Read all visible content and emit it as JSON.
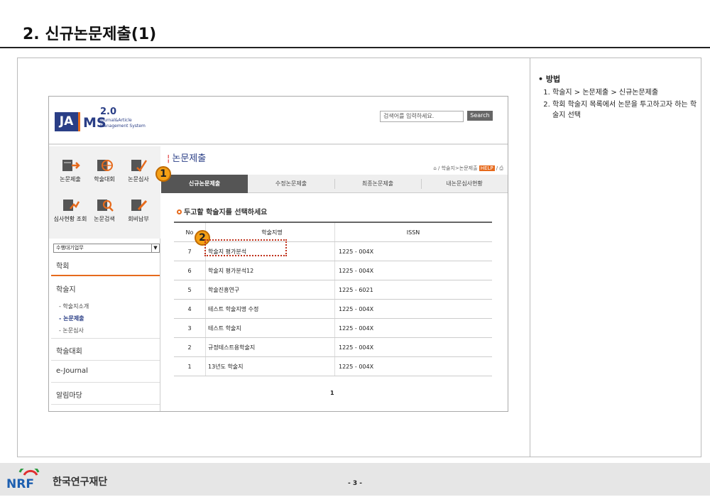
{
  "slide": {
    "title": "2. 신규논문제출(1)",
    "page_number": "- 3 -"
  },
  "notes": {
    "heading": "• 방법",
    "steps": [
      "학술지 > 논문제출 > 신규논문제출",
      "학회 학술지 목록에서 논문을 투고하고자 하는 학술지 선택"
    ]
  },
  "app": {
    "logo": {
      "ja": "JA",
      "ms": "MS",
      "version": "2.0",
      "subtitle": "Journal&Article Management System"
    },
    "search": {
      "placeholder": "검색어를 입력하세요.",
      "button": "Search"
    },
    "quick_icons": [
      {
        "label": "논문제출",
        "icon": "document-arrow-icon"
      },
      {
        "label": "학술대회",
        "icon": "globe-document-icon"
      },
      {
        "label": "논문심사",
        "icon": "pencil-check-icon"
      },
      {
        "label": "심사현황 조회",
        "icon": "chart-document-icon"
      },
      {
        "label": "논문검색",
        "icon": "magnifier-document-icon"
      },
      {
        "label": "회비납부",
        "icon": "pencil-document-icon"
      }
    ],
    "quick_select": "수행대기업무",
    "menu": {
      "society": "학회",
      "journal": "학술지",
      "journal_sub": [
        "- 학술지소개",
        "- 논문제출",
        "- 논문심사"
      ],
      "conference": "학술대회",
      "ejournal": "e-Journal",
      "notice": "알림마당"
    },
    "page_heading": "논문제출",
    "breadcrumb": {
      "path": "학술지>논문제출",
      "tag": "HELP"
    },
    "tabs": [
      "신규논문제출",
      "수정논문제출",
      "최종논문제출",
      "내논문심사현황"
    ],
    "active_tab": 0,
    "section_title": "두고할 학술지를 선택하세요",
    "table": {
      "headers": [
        "No",
        "학술지명",
        "ISSN"
      ],
      "rows": [
        {
          "no": "7",
          "name": "학술지 평가분석",
          "issn": "1225 - 004X"
        },
        {
          "no": "6",
          "name": "학술지 평가분석12",
          "issn": "1225 - 004X"
        },
        {
          "no": "5",
          "name": "학술진흥연구",
          "issn": "1225 - 6021"
        },
        {
          "no": "4",
          "name": "테스트 학술지명 수정",
          "issn": "1225 - 004X"
        },
        {
          "no": "3",
          "name": "테스트 학술지",
          "issn": "1225 - 004X"
        },
        {
          "no": "2",
          "name": "규정테스트용학술지",
          "issn": "1225 - 004X"
        },
        {
          "no": "1",
          "name": "13년도 학술지",
          "issn": "1225 - 004X"
        }
      ]
    },
    "pager": "1"
  },
  "callouts": [
    "1",
    "2"
  ],
  "footer": {
    "logo_text": "NRF",
    "org": "한국연구재단"
  },
  "colors": {
    "accent": "#e66a1c",
    "brand": "#2a3e86",
    "callout": "#f5a015",
    "highlight": "#c0301a"
  }
}
